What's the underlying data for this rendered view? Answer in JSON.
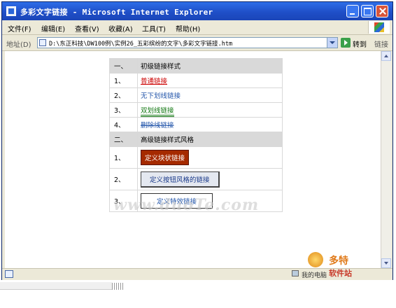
{
  "window": {
    "title": "多彩文字链接 - Microsoft Internet Explorer"
  },
  "menu": {
    "items": [
      "文件(F)",
      "编辑(E)",
      "查看(V)",
      "收藏(A)",
      "工具(T)",
      "帮助(H)"
    ]
  },
  "address": {
    "label": "地址(D)",
    "url": "D:\\东正科技\\DW100例\\实例26_五彩缤纷的文字\\多彩文字链接.htm",
    "go_label": "转到",
    "links_label": "链接"
  },
  "table": {
    "section1": {
      "num": "一、",
      "title": "初级链接样式"
    },
    "rows1": [
      {
        "num": "1、",
        "label": "普通链接"
      },
      {
        "num": "2、",
        "label": "无下划线链接"
      },
      {
        "num": "3、",
        "label": "双划线链接"
      },
      {
        "num": "4、",
        "label": "删除线链接"
      }
    ],
    "section2": {
      "num": "二、",
      "title": "高级链接样式风格"
    },
    "rows2": [
      {
        "num": "1、",
        "label": "定义块状链接"
      },
      {
        "num": "2、",
        "label": "定义按钮风格的链接"
      },
      {
        "num": "3、",
        "label": "定义特效链接"
      }
    ]
  },
  "watermark": "www.duoTe.com",
  "status": {
    "zone": "我的电脑"
  },
  "logo": {
    "text": "多特",
    "sub": "软件站"
  },
  "colors": {
    "title_bar": "#1f4fc8",
    "header_row": "#d9d9d9",
    "block_link": "#a52a00",
    "link_blue": "#2255aa"
  }
}
